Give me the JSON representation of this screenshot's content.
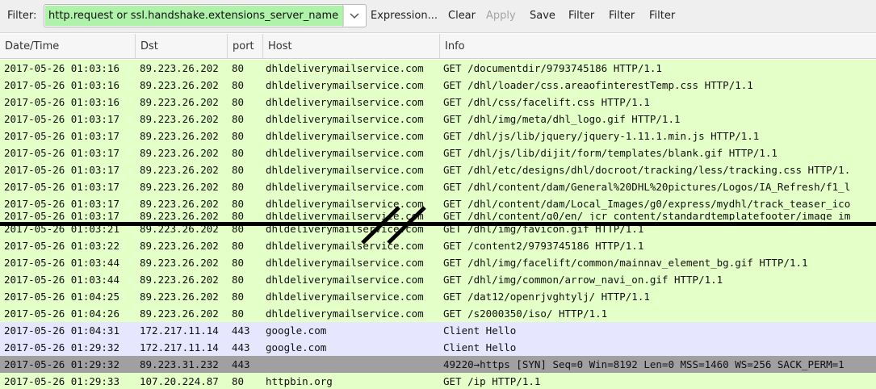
{
  "toolbar": {
    "filter_label": "Filter:",
    "filter_value": "http.request or ssl.handshake.extensions_server_name",
    "buttons": [
      "Expression...",
      "Clear",
      "Apply",
      "Save",
      "Filter",
      "Filter",
      "Filter"
    ]
  },
  "columns": [
    "Date/Time",
    "Dst",
    "port",
    "Host",
    "Info"
  ],
  "colors": {
    "http": "#e4ffc7",
    "ssl": "#e7e6ff",
    "tcp": "#a0a0a0",
    "filter_ok": "#aff2a9"
  },
  "rows": [
    {
      "time": "2017-05-26 01:03:16",
      "dst": "89.223.26.202",
      "port": "80",
      "host": "dhldeliverymailservice.com",
      "info": "GET /documentdir/9793745186 HTTP/1.1",
      "kind": "http"
    },
    {
      "time": "2017-05-26 01:03:16",
      "dst": "89.223.26.202",
      "port": "80",
      "host": "dhldeliverymailservice.com",
      "info": "GET /dhl/loader/css.areaofinterestTemp.css HTTP/1.1",
      "kind": "http"
    },
    {
      "time": "2017-05-26 01:03:16",
      "dst": "89.223.26.202",
      "port": "80",
      "host": "dhldeliverymailservice.com",
      "info": "GET /dhl/css/facelift.css HTTP/1.1",
      "kind": "http"
    },
    {
      "time": "2017-05-26 01:03:17",
      "dst": "89.223.26.202",
      "port": "80",
      "host": "dhldeliverymailservice.com",
      "info": "GET /dhl/img/meta/dhl_logo.gif HTTP/1.1",
      "kind": "http"
    },
    {
      "time": "2017-05-26 01:03:17",
      "dst": "89.223.26.202",
      "port": "80",
      "host": "dhldeliverymailservice.com",
      "info": "GET /dhl/js/lib/jquery/jquery-1.11.1.min.js HTTP/1.1",
      "kind": "http"
    },
    {
      "time": "2017-05-26 01:03:17",
      "dst": "89.223.26.202",
      "port": "80",
      "host": "dhldeliverymailservice.com",
      "info": "GET /dhl/js/lib/dijit/form/templates/blank.gif HTTP/1.1",
      "kind": "http"
    },
    {
      "time": "2017-05-26 01:03:17",
      "dst": "89.223.26.202",
      "port": "80",
      "host": "dhldeliverymailservice.com",
      "info": "GET /dhl/etc/designs/dhl/docroot/tracking/less/tracking.css HTTP/1.",
      "kind": "http"
    },
    {
      "time": "2017-05-26 01:03:17",
      "dst": "89.223.26.202",
      "port": "80",
      "host": "dhldeliverymailservice.com",
      "info": "GET /dhl/content/dam/General%20DHL%20pictures/Logos/IA_Refresh/f1_l",
      "kind": "http"
    },
    {
      "time": "2017-05-26 01:03:17",
      "dst": "89.223.26.202",
      "port": "80",
      "host": "dhldeliverymailservice.com",
      "info": "GET /dhl/content/dam/Local_Images/g0/express/mydhl/track_teaser_ico",
      "kind": "http"
    },
    {
      "time": "2017-05-26 01:03:17",
      "dst": "89.223.26.202",
      "port": "80",
      "host": "dhldeliverymailservice.com",
      "info": "GET /dhl/content/g0/en/_jcr_content/standardtemplatefooter/image_im",
      "kind": "http"
    },
    {
      "time": "2017-05-26 01:03:21",
      "dst": "89.223.26.202",
      "port": "80",
      "host": "dhldeliverymailservice.com",
      "info": "GET /dhl/img/favicon.gif HTTP/1.1",
      "kind": "http"
    },
    {
      "time": "2017-05-26 01:03:22",
      "dst": "89.223.26.202",
      "port": "80",
      "host": "dhldeliverymailservice.com",
      "info": "GET /content2/9793745186 HTTP/1.1",
      "kind": "http"
    },
    {
      "time": "2017-05-26 01:03:44",
      "dst": "89.223.26.202",
      "port": "80",
      "host": "dhldeliverymailservice.com",
      "info": "GET /dhl/img/facelift/common/mainnav_element_bg.gif HTTP/1.1",
      "kind": "http"
    },
    {
      "time": "2017-05-26 01:03:44",
      "dst": "89.223.26.202",
      "port": "80",
      "host": "dhldeliverymailservice.com",
      "info": "GET /dhl/img/common/arrow_navi_on.gif HTTP/1.1",
      "kind": "http"
    },
    {
      "time": "2017-05-26 01:04:25",
      "dst": "89.223.26.202",
      "port": "80",
      "host": "dhldeliverymailservice.com",
      "info": "GET /dat12/openrjvghtylj/ HTTP/1.1",
      "kind": "http"
    },
    {
      "time": "2017-05-26 01:04:26",
      "dst": "89.223.26.202",
      "port": "80",
      "host": "dhldeliverymailservice.com",
      "info": "GET /s2000350/iso/ HTTP/1.1",
      "kind": "http"
    },
    {
      "time": "2017-05-26 01:04:31",
      "dst": "172.217.11.14",
      "port": "443",
      "host": "google.com",
      "info": "Client Hello",
      "kind": "ssl"
    },
    {
      "time": "2017-05-26 01:29:32",
      "dst": "172.217.11.14",
      "port": "443",
      "host": "google.com",
      "info": "Client Hello",
      "kind": "ssl"
    },
    {
      "time": "2017-05-26 01:29:32",
      "dst": "89.223.31.232",
      "port": "443",
      "host": "",
      "info": "49220→https [SYN] Seq=0 Win=8192 Len=0 MSS=1460 WS=256 SACK_PERM=1",
      "kind": "tcp"
    },
    {
      "time": "2017-05-26 01:29:33",
      "dst": "107.20.224.87",
      "port": "80",
      "host": "httpbin.org",
      "info": "GET /ip HTTP/1.1",
      "kind": "http"
    }
  ]
}
